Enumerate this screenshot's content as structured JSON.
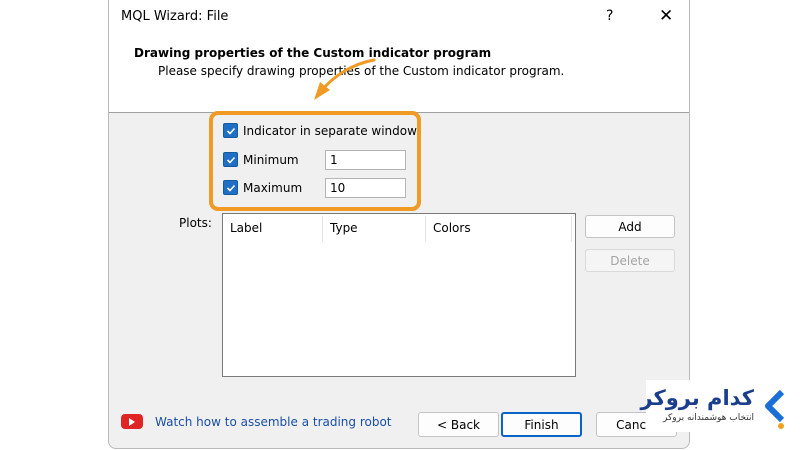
{
  "window": {
    "title": "MQL Wizard: File",
    "help_label": "?",
    "close_label": "✕"
  },
  "header": {
    "title": "Drawing properties of the Custom indicator program",
    "subtitle": "Please specify drawing properties of the Custom indicator program."
  },
  "options": {
    "separate_window": {
      "label": "Indicator in separate window",
      "checked": true
    },
    "minimum": {
      "label": "Minimum",
      "checked": true,
      "value": "1"
    },
    "maximum": {
      "label": "Maximum",
      "checked": true,
      "value": "10"
    }
  },
  "plots": {
    "label": "Plots:",
    "columns": [
      "Label",
      "Type",
      "Colors"
    ],
    "rows": []
  },
  "buttons": {
    "add": "Add",
    "delete": "Delete",
    "back": "< Back",
    "finish": "Finish",
    "cancel": "Cancel"
  },
  "footer": {
    "link": "Watch how to assemble a trading robot"
  },
  "brand": {
    "name": "کدام بروکر",
    "tagline": "انتخاب هوشمندانه بروکر"
  },
  "colors": {
    "highlight": "#ef9b25",
    "checkbox": "#1f6fc4",
    "link": "#1a4fa8",
    "brand": "#1a3e8c"
  },
  "icons": [
    "help-icon",
    "close-icon",
    "check-icon",
    "youtube-icon",
    "arrow-annotation-icon",
    "brand-logo-icon"
  ]
}
